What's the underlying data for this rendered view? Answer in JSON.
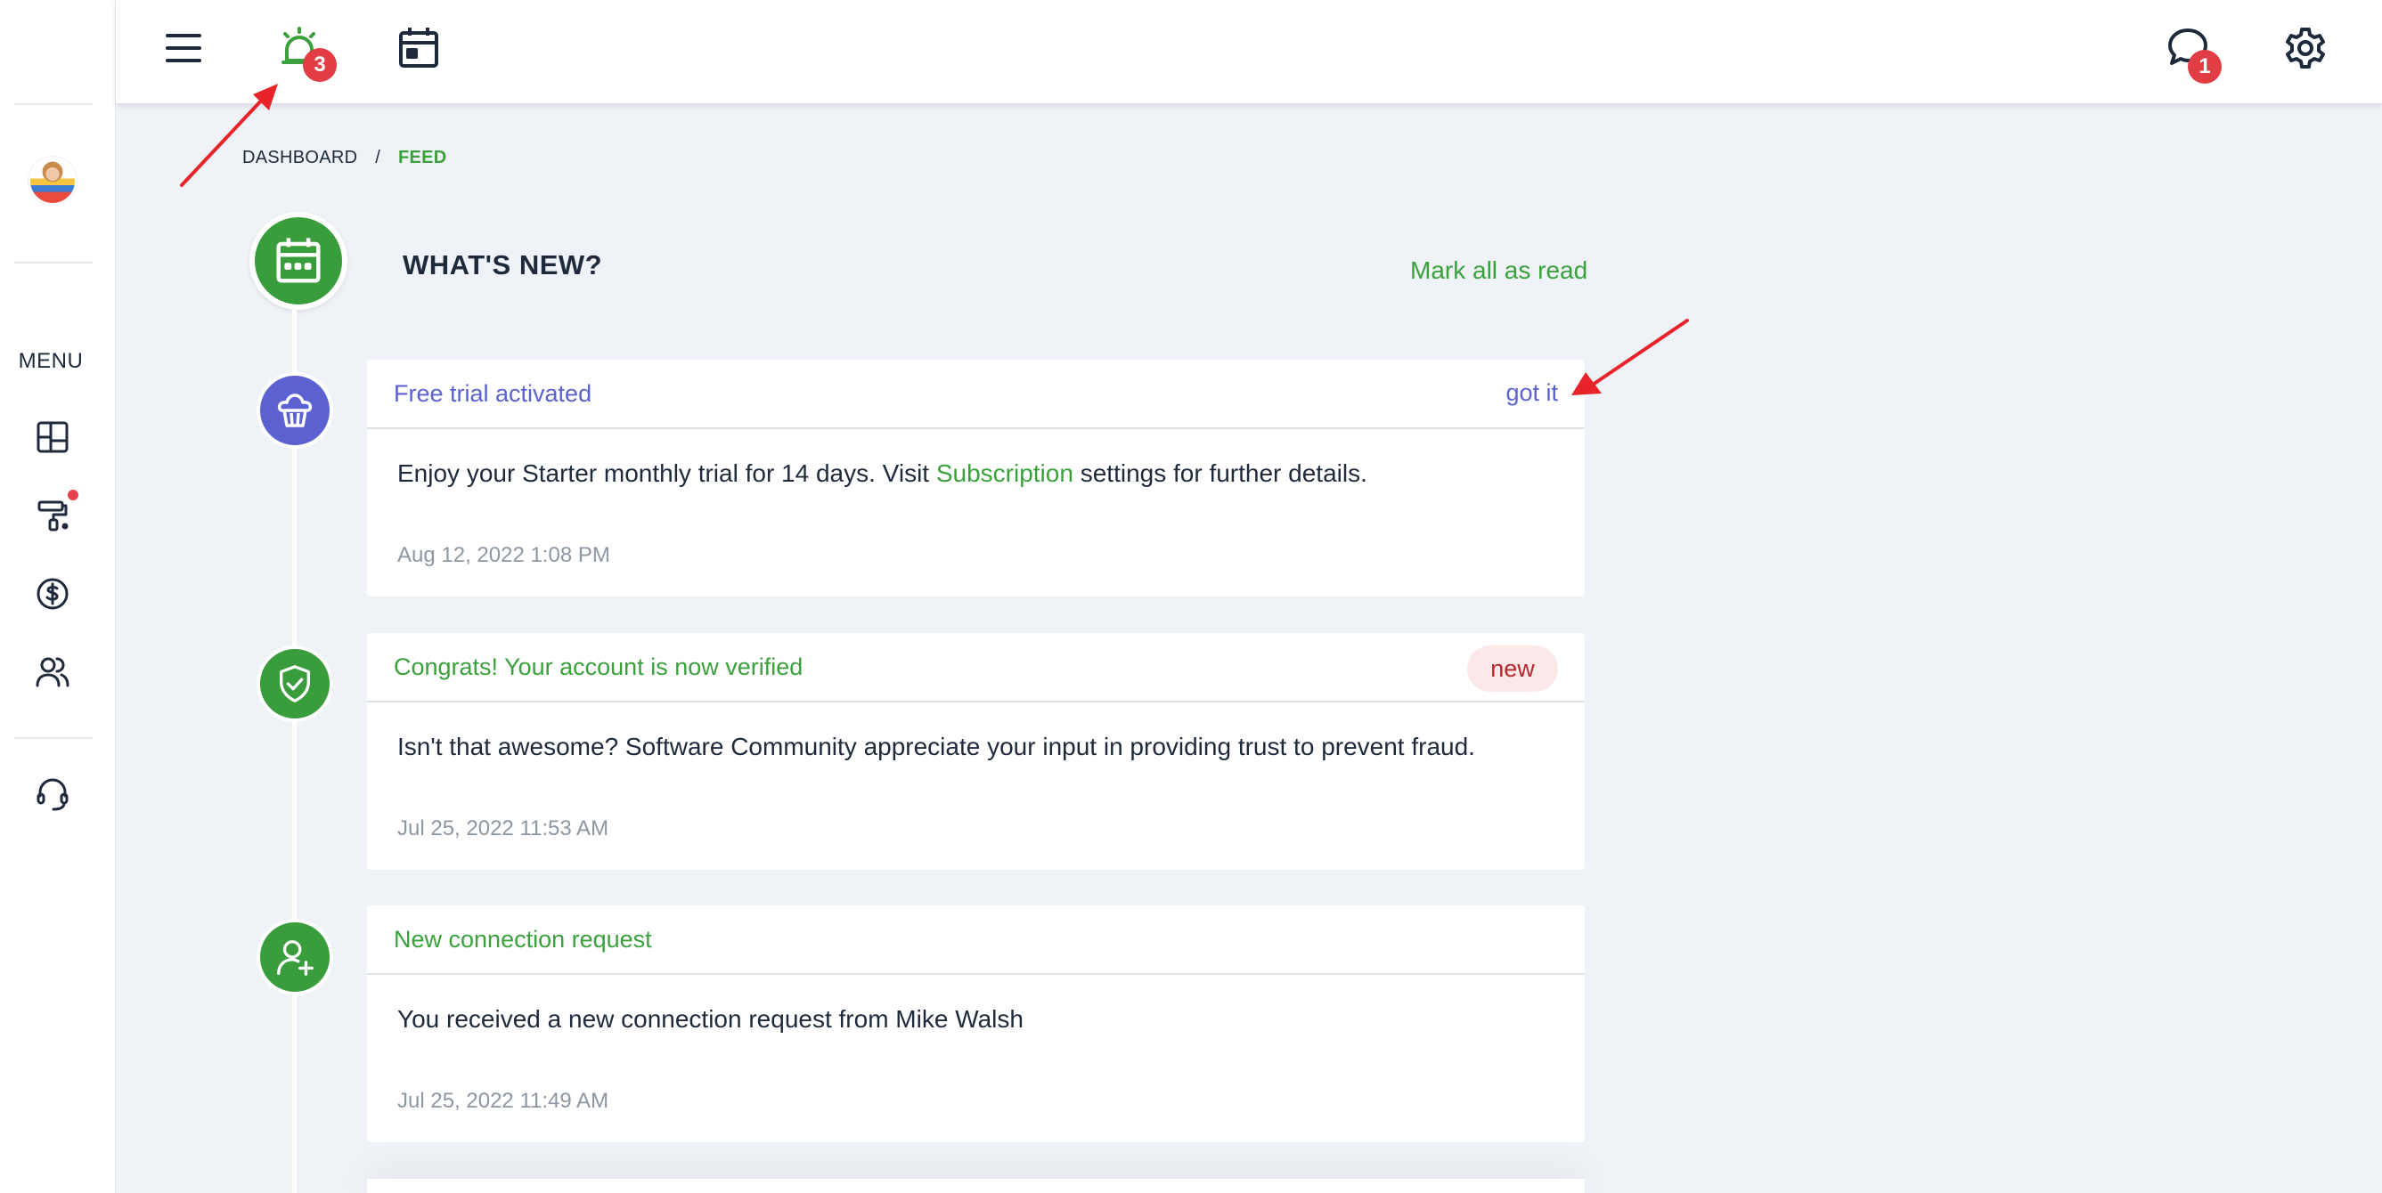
{
  "topbar": {
    "notifications_badge": "3",
    "messages_badge": "1"
  },
  "sidebar": {
    "menu_label": "MENU",
    "items": [
      "dashboard",
      "painting-service",
      "billing",
      "users",
      "support"
    ]
  },
  "breadcrumb": {
    "items": [
      "DASHBOARD",
      "FEED"
    ],
    "separator": "/"
  },
  "feed": {
    "title": "WHAT'S NEW?",
    "mark_all_label": "Mark all as read",
    "items": [
      {
        "title": "Free trial activated",
        "action": "got it",
        "text_before": "Enjoy your Starter monthly trial for 14 days. Visit ",
        "link": "Subscription",
        "text_after": " settings for further details.",
        "date": "Aug 12, 2022 1:08 PM",
        "icon": "cupcake-icon",
        "color": "#5b61d0"
      },
      {
        "title": "Congrats! Your account is now verified",
        "badge": "new",
        "text": "Isn't that awesome? Software Community appreciate your input in providing trust to prevent fraud.",
        "date": "Jul 25, 2022 11:53 AM",
        "icon": "shield-check-icon",
        "color": "#3a9d3c"
      },
      {
        "title": "New connection request",
        "text": "You received a new connection request from Mike Walsh",
        "date": "Jul 25, 2022 11:49 AM",
        "icon": "user-plus-icon",
        "color": "#3a9d3c"
      }
    ]
  },
  "colors": {
    "accent_green": "#3aa13d",
    "accent_purple": "#5b61d0",
    "badge_red": "#e23c45",
    "background": "#eff2f7"
  }
}
